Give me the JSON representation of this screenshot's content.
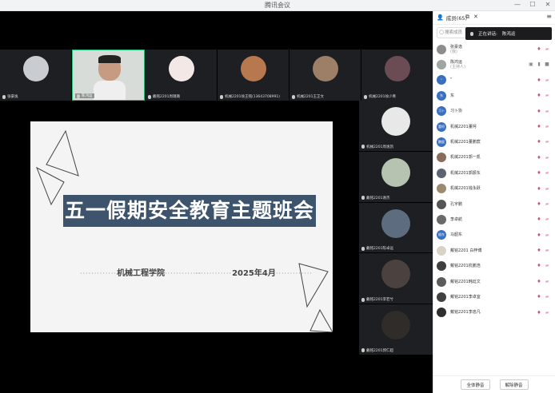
{
  "window": {
    "title": "腾讯会议"
  },
  "strip": [
    {
      "name": "张豪逸",
      "color": "#c9ccd0"
    },
    {
      "name": "陈鸿运",
      "color": "#d8dcd9",
      "active": true
    },
    {
      "name": "戴铭2201周璐璐",
      "color": "#f3e8e6"
    },
    {
      "name": "机械2201徐王铭(13643708991)",
      "color": "#b8784f"
    },
    {
      "name": "机械2201王芷文",
      "color": "#9d7e67"
    },
    {
      "name": "机械2201徐少菁",
      "color": "#6b4c55"
    }
  ],
  "slide": {
    "title": "五一假期安全教育主题班会",
    "school": "机械工程学院",
    "date": "2025年4月",
    "dots": "·············"
  },
  "mini": [
    {
      "name": "机械2201周逸凯",
      "color": "#e8e8e8"
    },
    {
      "name": "戴铭2201谢杰",
      "color": "#b7c3b1"
    },
    {
      "name": "戴铭2201陈卓远",
      "color": "#5d6c7e"
    },
    {
      "name": "戴铭2201李若兮",
      "color": "#4b4240"
    },
    {
      "name": "戴铭2201郭仁超",
      "color": "#2f2c2a"
    }
  ],
  "panel": {
    "header": "成员(65)",
    "search_placeholder": "搜索成员",
    "speaking_label": "正在讲话:",
    "speaking_name": "陈鸿运",
    "members": [
      {
        "name": "张豪逸",
        "role": "(我)",
        "color": "#8d8d8d",
        "initial": ""
      },
      {
        "name": "陈鸿运",
        "role": "(主持人)",
        "color": "#9fa5a0",
        "initial": "",
        "host": true
      },
      {
        "name": "“",
        "role": "",
        "color": "#3a6fbf",
        "initial": "“"
      },
      {
        "name": "东",
        "role": "",
        "color": "#3a6fbf",
        "initial": "东"
      },
      {
        "name": "习卜协",
        "role": "",
        "color": "#3a6fbf",
        "initial": "习卜"
      },
      {
        "name": "机械2201董柯",
        "role": "",
        "color": "#3a6fbf",
        "initial": "董柯"
      },
      {
        "name": "机械2201董鹏宸",
        "role": "",
        "color": "#3a6fbf",
        "initial": "鹏宸"
      },
      {
        "name": "机械2201郭一凯",
        "role": "",
        "color": "#8a6c5c",
        "initial": ""
      },
      {
        "name": "机械2201郭振东",
        "role": "",
        "color": "#5b6470",
        "initial": ""
      },
      {
        "name": "机械2201钱永跃",
        "role": "",
        "color": "#9a8a6f",
        "initial": ""
      },
      {
        "name": "孔宇鹏",
        "role": "",
        "color": "#555",
        "initial": ""
      },
      {
        "name": "李卓航",
        "role": "",
        "color": "#6a6a6a",
        "initial": ""
      },
      {
        "name": "马韶东",
        "role": "",
        "color": "#3a6fbf",
        "initial": "韶东"
      },
      {
        "name": "戴铭2201 白梓博",
        "role": "",
        "color": "#d9d3c7",
        "initial": ""
      },
      {
        "name": "戴铭2201杭鹏浩",
        "role": "",
        "color": "#3f3f3f",
        "initial": ""
      },
      {
        "name": "戴铭2201韩廷文",
        "role": "",
        "color": "#5b5b5b",
        "initial": ""
      },
      {
        "name": "戴铭2201李卓宜",
        "role": "",
        "color": "#404040",
        "initial": ""
      },
      {
        "name": "戴铭2201李逸凡",
        "role": "",
        "color": "#2e2e2e",
        "initial": ""
      }
    ],
    "mute_all": "全体静音",
    "unmute_all": "解除静音"
  }
}
